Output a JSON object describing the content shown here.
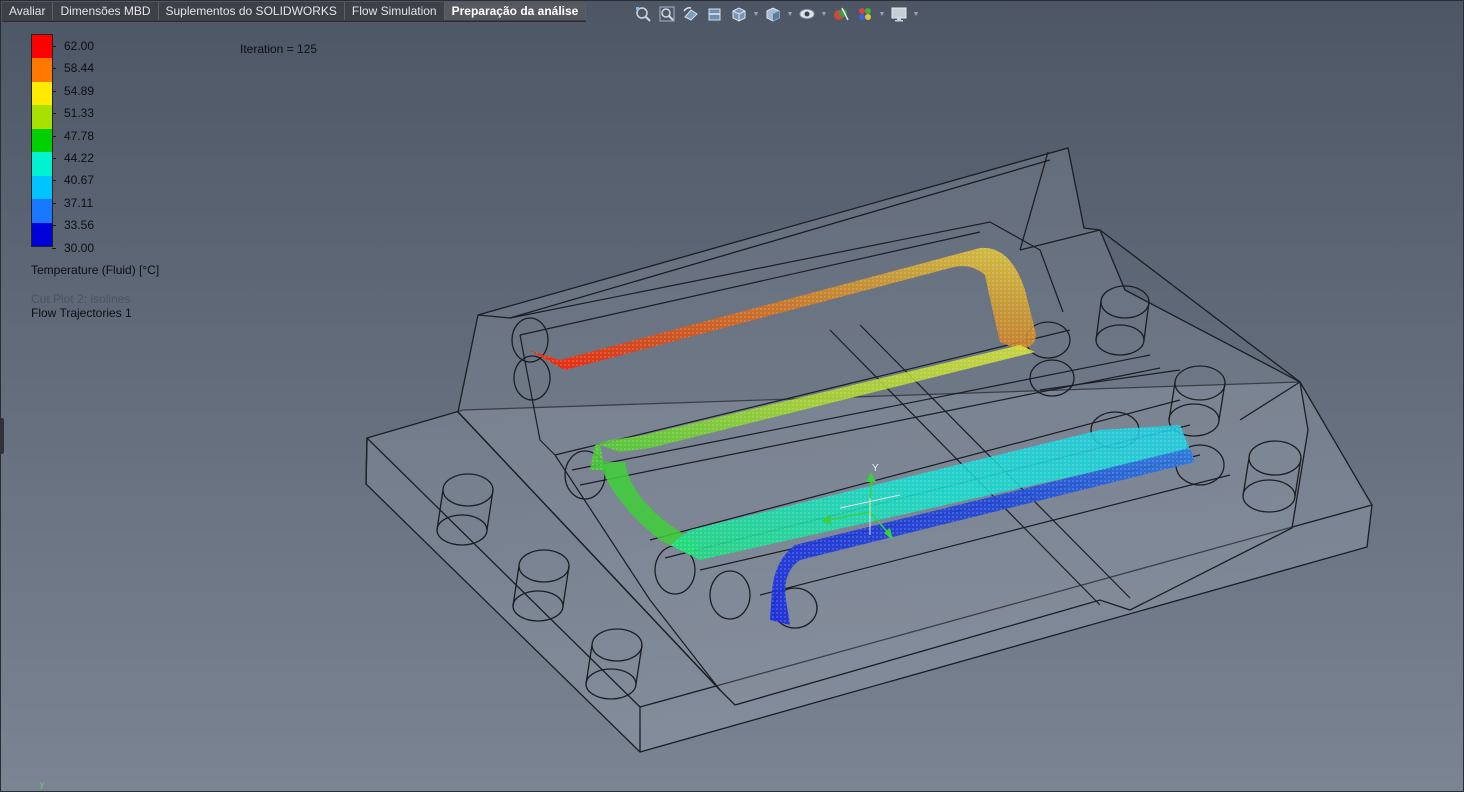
{
  "tabs": [
    "Avaliar",
    "Dimensões MBD",
    "Suplementos do SOLIDWORKS",
    "Flow Simulation",
    "Preparação da análise"
  ],
  "active_tab_index": 4,
  "heads_up_toolbar": [
    "zoom-to-fit-icon",
    "zoom-to-area-icon",
    "previous-view-icon",
    "section-view-icon",
    "view-orientation-icon",
    "display-style-icon",
    "hide-show-items-icon",
    "edit-appearance-icon",
    "apply-scene-icon",
    "view-settings-icon"
  ],
  "legend": {
    "values": [
      "62.00",
      "58.44",
      "54.89",
      "51.33",
      "47.78",
      "44.22",
      "40.67",
      "37.11",
      "33.56",
      "30.00"
    ],
    "colors": [
      "#ff0000",
      "#ff7800",
      "#ffea00",
      "#a8e000",
      "#00d000",
      "#00f2d0",
      "#00c4ff",
      "#1878ff",
      "#0000d8"
    ],
    "title": "Temperature (Fluid) [°C]",
    "feature_1": "Cut Plot 2: isolines",
    "feature_2": "Flow Trajectories 1"
  },
  "iteration_text": "Iteration = 125",
  "axis_label": "Y",
  "corner_axis": "y"
}
